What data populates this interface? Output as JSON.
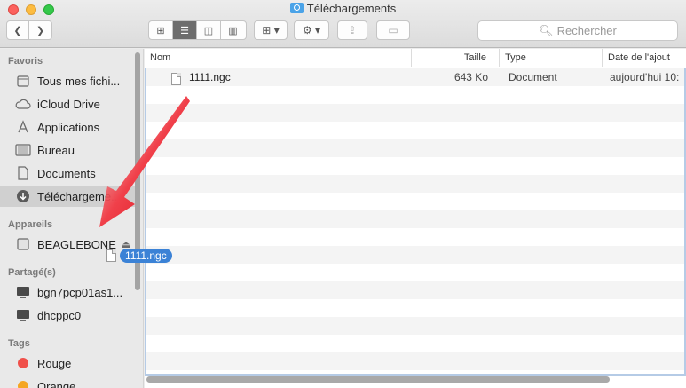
{
  "window": {
    "title": "Téléchargements"
  },
  "toolbar": {
    "back_icon": "chevron-left-icon",
    "forward_icon": "chevron-right-icon",
    "views": [
      "icon-view",
      "list-view",
      "column-view",
      "coverflow-view"
    ],
    "search_placeholder": "Rechercher"
  },
  "sidebar": {
    "favorites_header": "Favoris",
    "favorites": [
      {
        "label": "Tous mes fichi...",
        "icon": "all-files-icon"
      },
      {
        "label": "iCloud Drive",
        "icon": "cloud-icon"
      },
      {
        "label": "Applications",
        "icon": "applications-icon"
      },
      {
        "label": "Bureau",
        "icon": "desktop-icon"
      },
      {
        "label": "Documents",
        "icon": "document-icon"
      },
      {
        "label": "Téléchargeme...",
        "icon": "download-icon",
        "selected": true
      }
    ],
    "devices_header": "Appareils",
    "devices": [
      {
        "label": "BEAGLEBONE",
        "icon": "drive-icon"
      }
    ],
    "shared_header": "Partagé(s)",
    "shared": [
      {
        "label": "bgn7pcp01as1...",
        "icon": "computer-icon"
      },
      {
        "label": "dhcppc0",
        "icon": "computer-icon"
      }
    ],
    "tags_header": "Tags",
    "tags": [
      {
        "label": "Rouge",
        "color": "#f0504a"
      },
      {
        "label": "Orange",
        "color": "#f5a623"
      }
    ]
  },
  "columns": {
    "name": "Nom",
    "size": "Taille",
    "type": "Type",
    "date": "Date de l'ajout"
  },
  "files": [
    {
      "name": "1111.ngc",
      "size": "643 Ko",
      "type": "Document",
      "date": "aujourd'hui 10:"
    }
  ],
  "drag": {
    "label": "1111.ngc"
  },
  "colors": {
    "selection": "#d0d0d0",
    "drag_pill": "#3b82d6",
    "arrow": "#e8121e",
    "focus_ring": "#b5cbe6"
  }
}
